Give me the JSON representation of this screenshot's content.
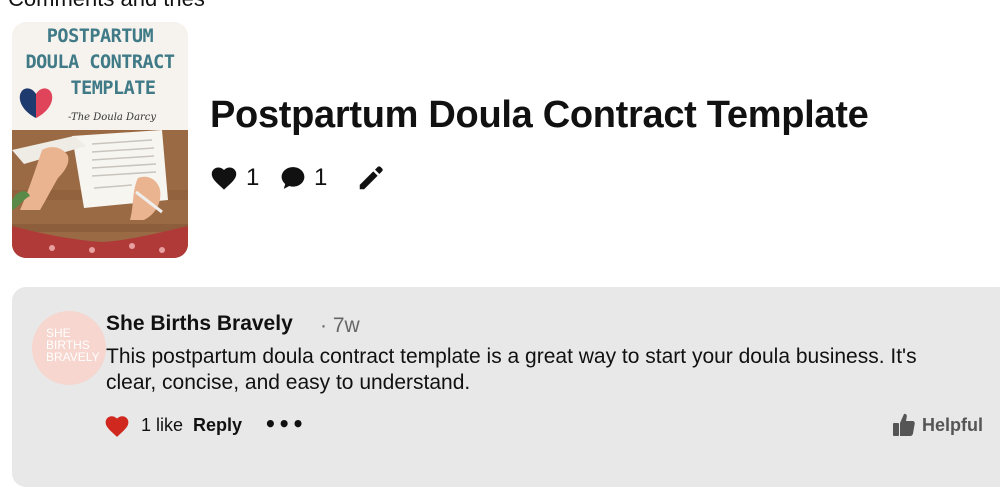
{
  "section_header": "Comments and tries",
  "pin": {
    "thumbnail": {
      "title_lines": [
        "POSTPARTUM",
        "DOULA CONTRACT",
        "TEMPLATE"
      ],
      "byline": "-The Doula Darcy"
    },
    "title": "Postpartum Doula Contract Template",
    "likes": "1",
    "comments": "1"
  },
  "comment": {
    "avatar_text": [
      "SHE",
      "BIRTHS",
      "BRAVELY"
    ],
    "author": "She Births Bravely",
    "time": "· 7w",
    "text": "This postpartum doula contract template is a great way to start your doula business. It's clear, concise, and easy to understand.",
    "like_count": "1 like",
    "reply_label": "Reply",
    "more_label": "•••",
    "helpful_label": "Helpful"
  },
  "colors": {
    "accent_teal": "#3f7a86",
    "heart_red": "#d0281f",
    "card_bg": "#e8e8e8"
  }
}
